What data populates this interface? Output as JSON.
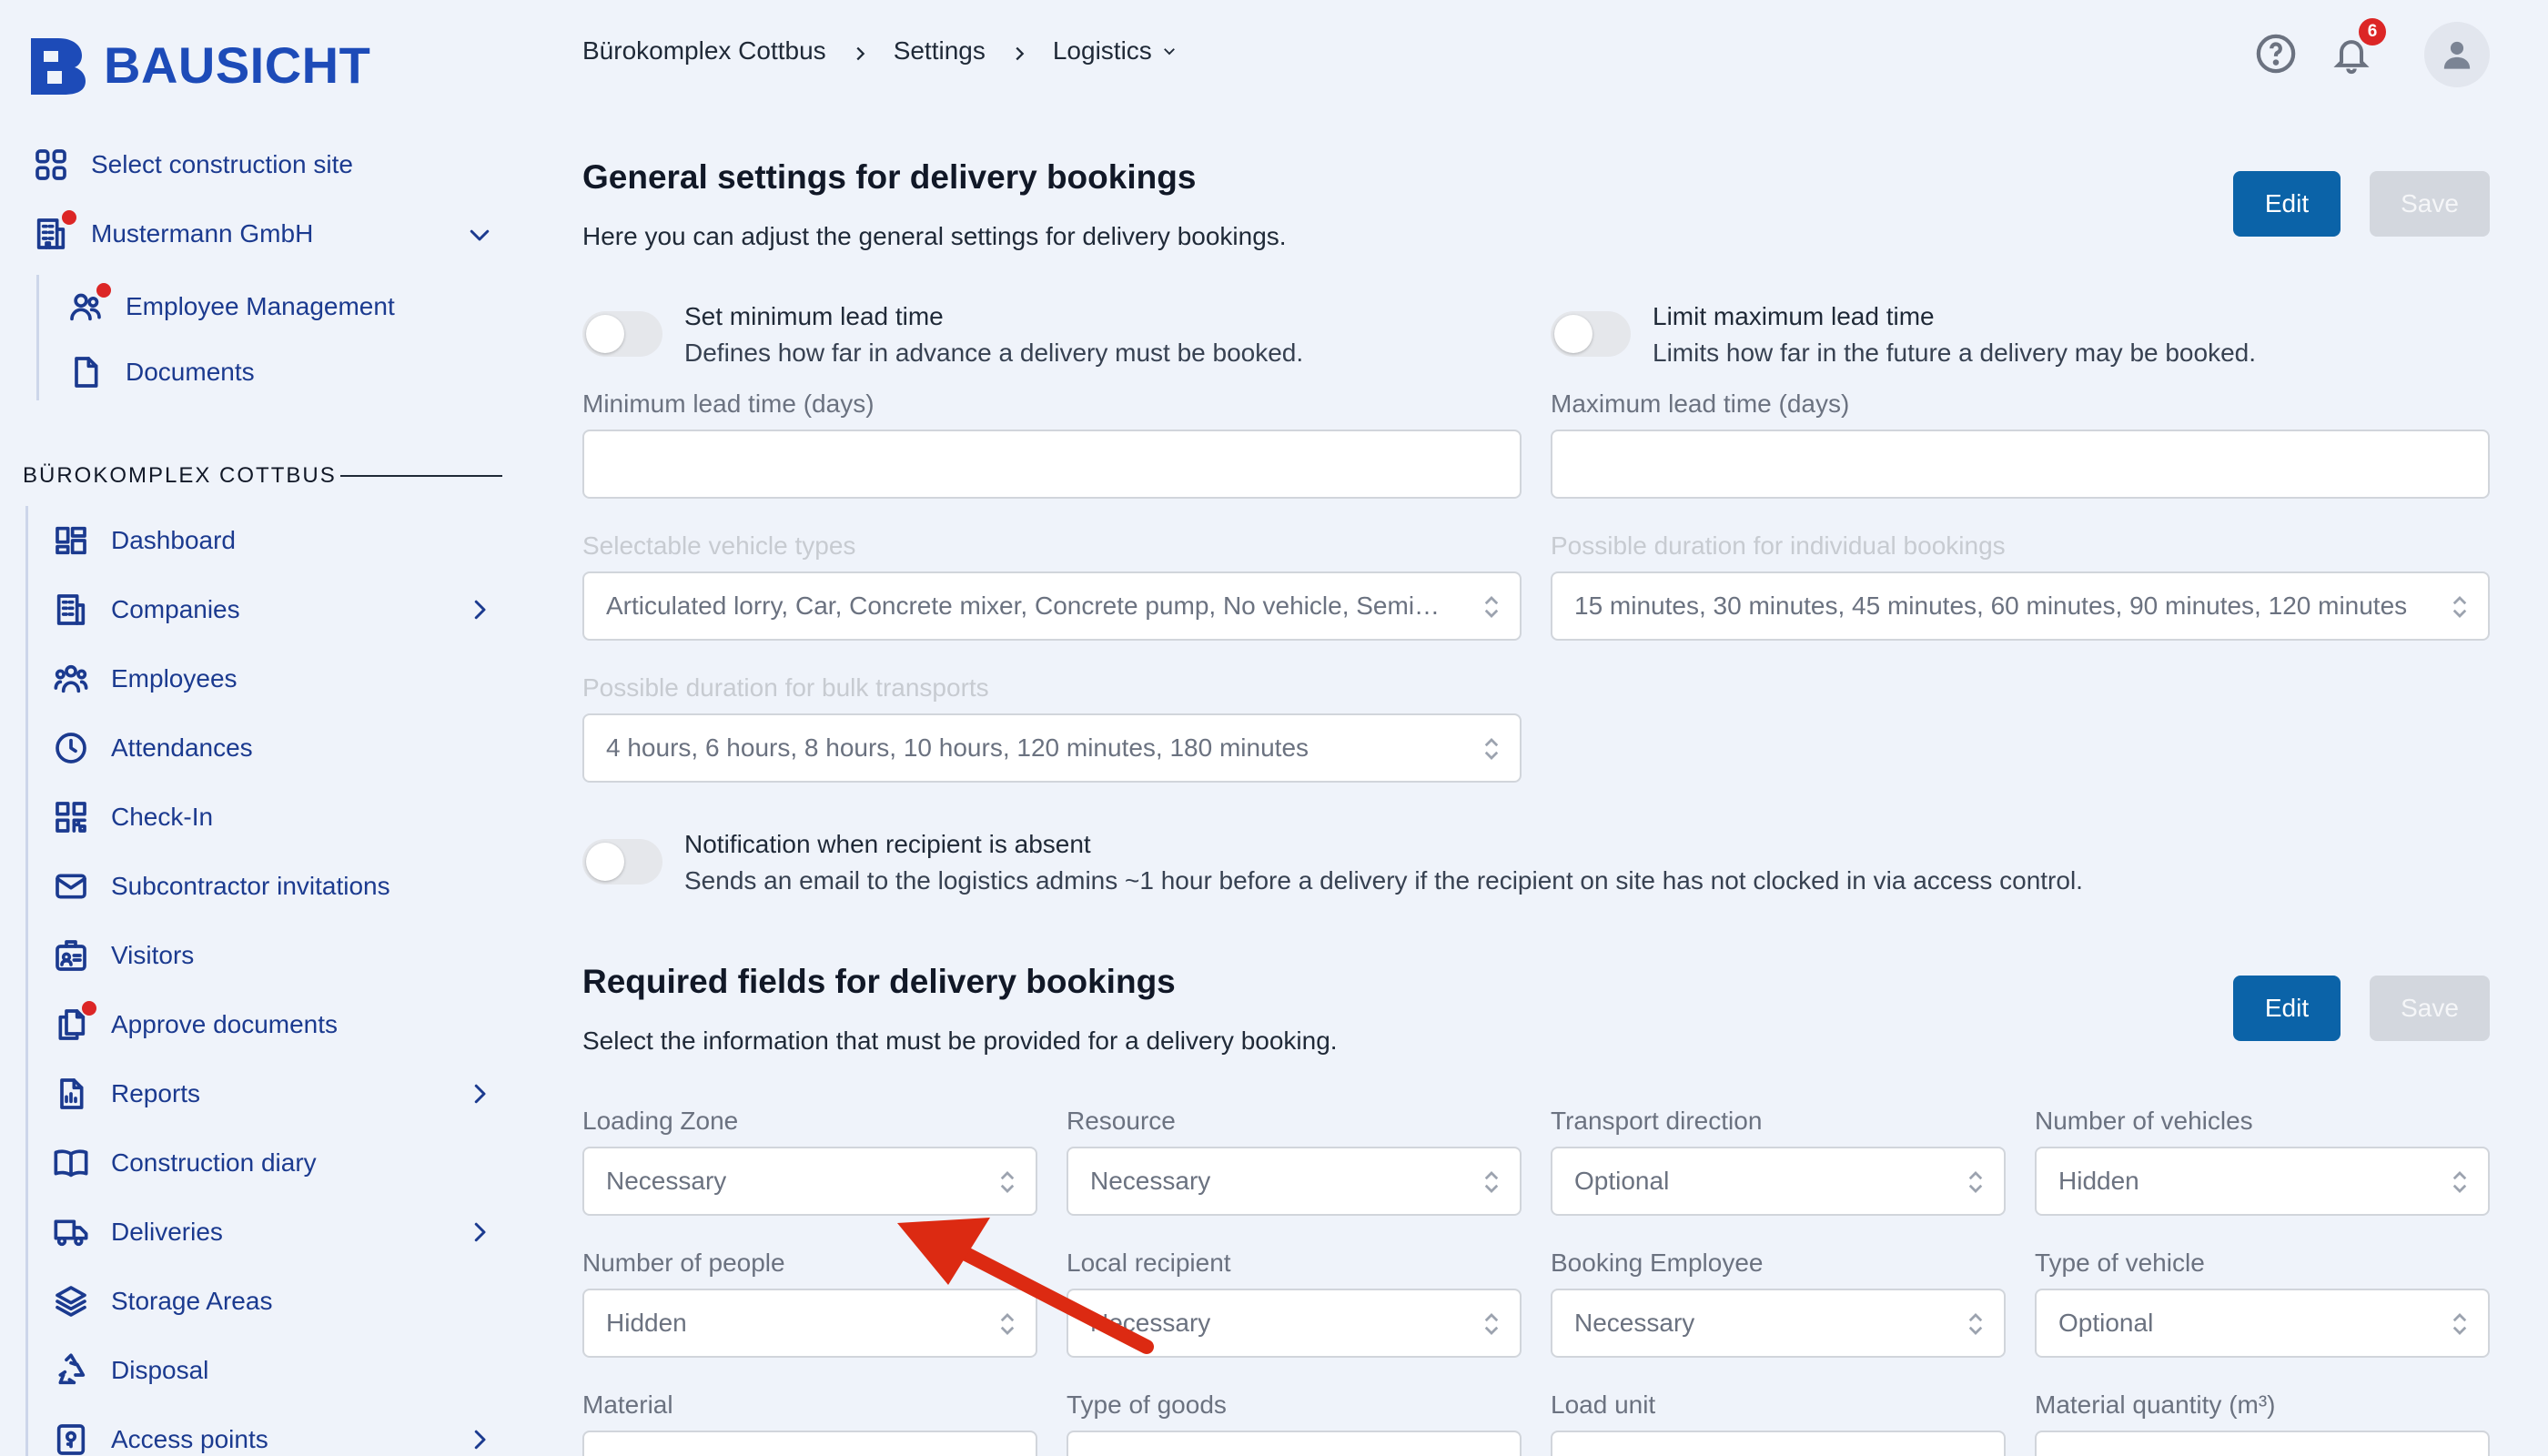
{
  "brand": {
    "name": "BAUSICHT"
  },
  "sidebar": {
    "top_items": [
      {
        "label": "Select construction site",
        "icon": "grid-icon"
      },
      {
        "label": "Mustermann GmbH",
        "icon": "building-icon",
        "dot": true
      }
    ],
    "company_sub": [
      {
        "label": "Employee Management",
        "icon": "users-icon",
        "dot": true
      },
      {
        "label": "Documents",
        "icon": "document-icon"
      }
    ],
    "section_title": "BÜROKOMPLEX COTTBUS",
    "items": [
      {
        "label": "Dashboard",
        "icon": "dashboard-icon"
      },
      {
        "label": "Companies",
        "icon": "building-icon",
        "chevron": true
      },
      {
        "label": "Employees",
        "icon": "users-icon"
      },
      {
        "label": "Attendances",
        "icon": "clock-icon"
      },
      {
        "label": "Check-In",
        "icon": "qr-icon"
      },
      {
        "label": "Subcontractor invitations",
        "icon": "mail-icon"
      },
      {
        "label": "Visitors",
        "icon": "id-badge-icon"
      },
      {
        "label": "Approve documents",
        "icon": "documents-icon",
        "dot": true
      },
      {
        "label": "Reports",
        "icon": "report-icon",
        "chevron": true
      },
      {
        "label": "Construction diary",
        "icon": "book-icon"
      },
      {
        "label": "Deliveries",
        "icon": "truck-icon",
        "chevron": true
      },
      {
        "label": "Storage Areas",
        "icon": "layers-icon"
      },
      {
        "label": "Disposal",
        "icon": "recycle-icon"
      },
      {
        "label": "Access points",
        "icon": "access-icon",
        "chevron": true
      }
    ]
  },
  "header": {
    "breadcrumb": [
      "Bürokomplex Cottbus",
      "Settings",
      "Logistics"
    ],
    "notifications_count": "6"
  },
  "general": {
    "title": "General settings for delivery bookings",
    "description": "Here you can adjust the general settings for delivery bookings.",
    "edit_label": "Edit",
    "save_label": "Save",
    "min_toggle": {
      "title": "Set minimum lead time",
      "sub": "Defines how far in advance a delivery must be booked."
    },
    "max_toggle": {
      "title": "Limit maximum lead time",
      "sub": "Limits how far in the future a delivery may be booked."
    },
    "min_label": "Minimum lead time (days)",
    "max_label": "Maximum lead time (days)",
    "vehicle_label": "Selectable vehicle types",
    "vehicle_value": "Articulated lorry, Car, Concrete mixer, Concrete pump, No vehicle, Semi-trailer",
    "duration_label": "Possible duration for individual bookings",
    "duration_value": "15 minutes, 30 minutes, 45 minutes, 60 minutes, 90 minutes, 120 minutes",
    "bulk_label": "Possible duration for bulk transports",
    "bulk_value": "4 hours, 6 hours, 8 hours, 10 hours, 120 minutes, 180 minutes",
    "absent_toggle": {
      "title": "Notification when recipient is absent",
      "sub": "Sends an email to the logistics admins ~1 hour before a delivery if the recipient on site has not clocked in via access control."
    }
  },
  "required": {
    "title": "Required fields for delivery bookings",
    "description": "Select the information that must be provided for a delivery booking.",
    "edit_label": "Edit",
    "save_label": "Save",
    "fields": [
      {
        "label": "Loading Zone",
        "value": "Necessary"
      },
      {
        "label": "Resource",
        "value": "Necessary"
      },
      {
        "label": "Transport direction",
        "value": "Optional"
      },
      {
        "label": "Number of vehicles",
        "value": "Hidden"
      },
      {
        "label": "Number of people",
        "value": "Hidden"
      },
      {
        "label": "Local recipient",
        "value": "Necessary"
      },
      {
        "label": "Booking Employee",
        "value": "Necessary"
      },
      {
        "label": "Type of vehicle",
        "value": "Optional"
      },
      {
        "label": "Material",
        "value": ""
      },
      {
        "label": "Type of goods",
        "value": ""
      },
      {
        "label": "Load unit",
        "value": ""
      },
      {
        "label": "Material quantity (m³)",
        "value": ""
      }
    ]
  },
  "colors": {
    "accent": "#0b63a8",
    "brand": "#1d4bb8",
    "nav": "#1b3a8f",
    "badge": "#dc2626",
    "arrow": "#dc2a12"
  }
}
